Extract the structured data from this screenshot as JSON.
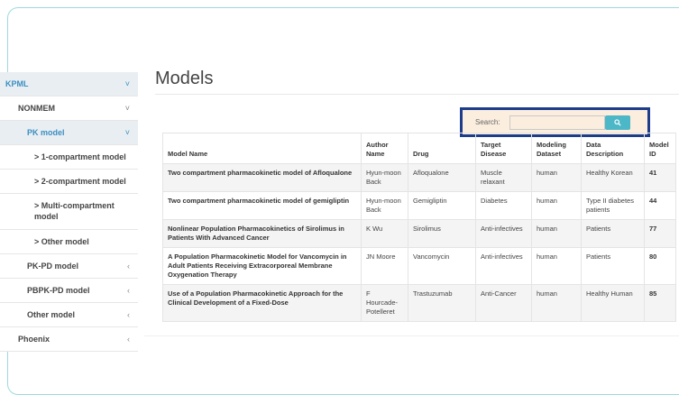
{
  "sidebar": {
    "items": [
      {
        "label": "KPML",
        "chevron": "˅"
      },
      {
        "label": "NONMEM",
        "chevron": "˅"
      },
      {
        "label": "PK model",
        "chevron": "˅"
      },
      {
        "label": "> 1-compartment model"
      },
      {
        "label": "> 2-compartment model"
      },
      {
        "label": "> Multi-compartment model"
      },
      {
        "label": "> Other model"
      },
      {
        "label": "PK-PD model",
        "chevron": "‹"
      },
      {
        "label": "PBPK-PD model",
        "chevron": "‹"
      },
      {
        "label": "Other model",
        "chevron": "‹"
      },
      {
        "label": "Phoenix",
        "chevron": "‹"
      }
    ]
  },
  "main": {
    "title": "Models",
    "search": {
      "label": "Search:",
      "value": "",
      "button_icon": "search-icon"
    }
  },
  "table": {
    "headers": [
      "Model Name",
      "Author Name",
      "Drug",
      "Target Disease",
      "Modeling Dataset",
      "Data Description",
      "Model ID"
    ],
    "rows": [
      [
        "Two compartment pharmacokinetic model of Afloqualone",
        "Hyun-moon Back",
        "Afloqualone",
        "Muscle relaxant",
        "human",
        "Healthy Korean",
        "41"
      ],
      [
        "Two compartment pharmacokinetic model of gemigliptin",
        "Hyun-moon Back",
        "Gemigliptin",
        "Diabetes",
        "human",
        "Type II diabetes patients",
        "44"
      ],
      [
        "Nonlinear Population Pharmacokinetics of Sirolimus in Patients With Advanced Cancer",
        "K Wu",
        "Sirolimus",
        "Anti-infectives",
        "human",
        "Patients",
        "77"
      ],
      [
        "A Population Pharmacokinetic Model for Vancomycin in Adult Patients Receiving Extracorporeal Membrane Oxygenation Therapy",
        "JN Moore",
        "Vancomycin",
        "Anti-infectives",
        "human",
        "Patients",
        "80"
      ],
      [
        "Use of a Population Pharmacokinetic Approach for the Clinical Development of a Fixed-Dose",
        "F Hourcade-Potelleret",
        "Trastuzumab",
        "Anti-Cancer",
        "human",
        "Healthy Human",
        "85"
      ]
    ]
  },
  "colors": {
    "accent": "#3b8fc0",
    "highlight_border": "#1d3c8a",
    "search_button": "#4cb7c6"
  }
}
